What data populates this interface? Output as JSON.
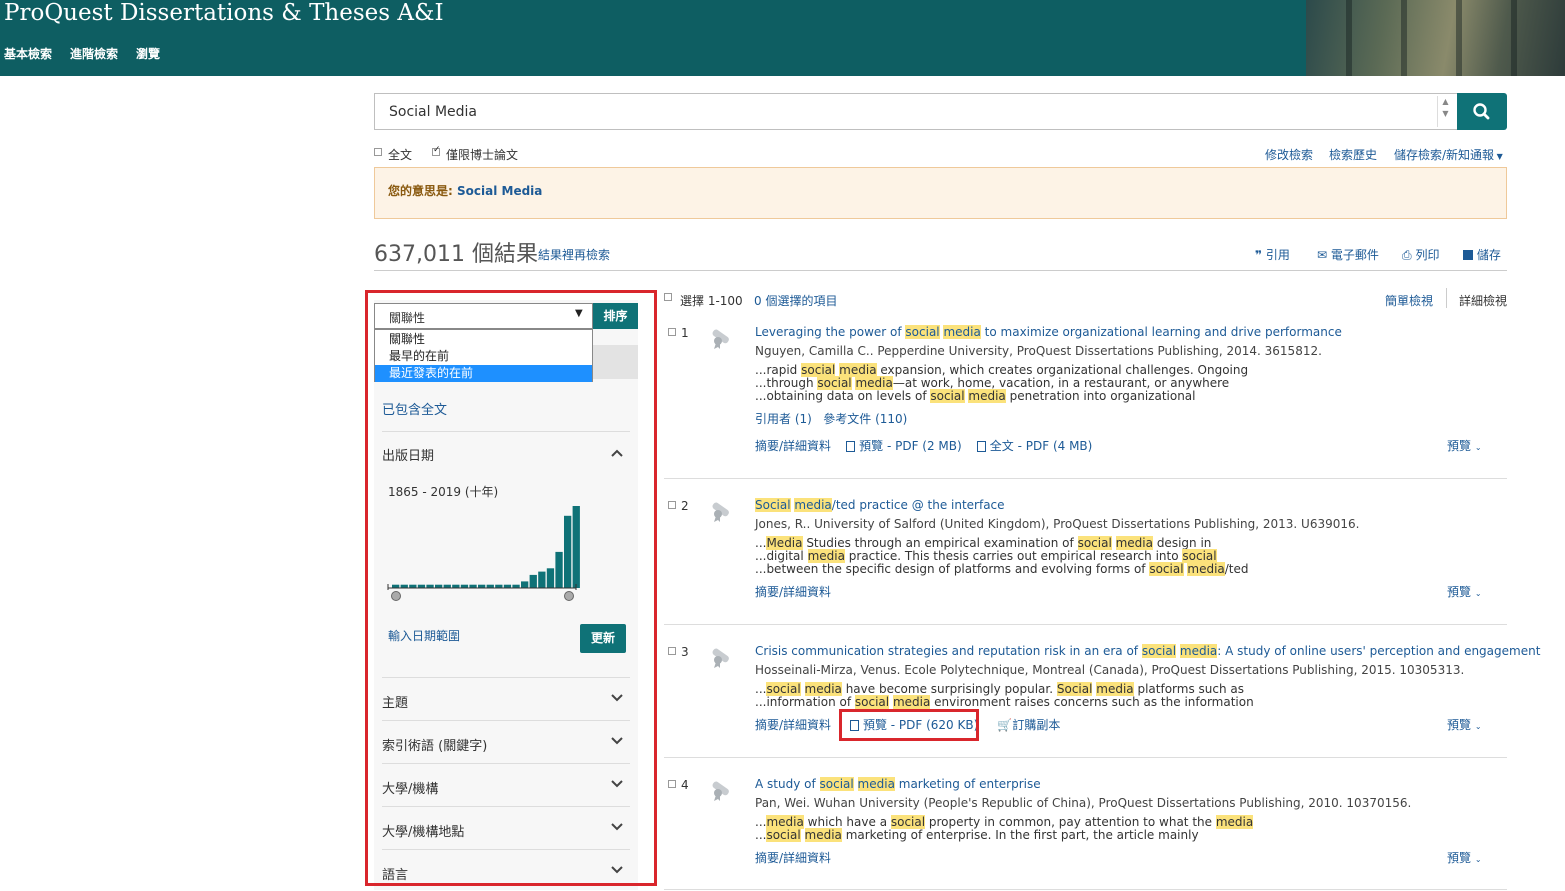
{
  "header": {
    "title": "ProQuest Dissertations & Theses A&I",
    "nav": [
      "基本檢索",
      "進階檢索",
      "瀏覽"
    ]
  },
  "search": {
    "query": "Social Media",
    "fulltext_label": "全文",
    "doctoral_only_label": "僅限博士論文",
    "doctoral_only_checked": true,
    "modify_search": "修改檢索",
    "search_history": "檢索歷史",
    "save_search": "儲存檢索/新知通報"
  },
  "didyoumean": {
    "label": "您的意思是:",
    "suggestion": "Social Media"
  },
  "results_header": {
    "count": "637,011 個結果",
    "refine": "結果裡再檢索",
    "actions": [
      "引用",
      "電子郵件",
      "列印",
      "儲存"
    ]
  },
  "sidebar": {
    "sort_selected": "關聯性",
    "sort_button": "排序",
    "sort_options": [
      "關聯性",
      "最早的在前",
      "最近發表的在前"
    ],
    "sort_highlighted_index": 2,
    "fulltext_included": "已包含全文",
    "pub_date_label": "出版日期",
    "date_range_text": "1865 - 2019 (十年)",
    "date_histogram": [
      1,
      1,
      1,
      1,
      1,
      1,
      1,
      1,
      1,
      1,
      1,
      1,
      1,
      1,
      1,
      2,
      4,
      5,
      6,
      11,
      22,
      25
    ],
    "enter_range": "輸入日期範圍",
    "update_button": "更新",
    "facets": [
      "主題",
      "索引術語 (關鍵字)",
      "大學/機構",
      "大學/機構地點",
      "語言"
    ]
  },
  "results_toolbar": {
    "select_label": "選擇 1-100",
    "selected_count": "0 個選擇的項目",
    "brief_view": "簡單檢視",
    "detailed_view": "詳細檢視"
  },
  "results": [
    {
      "num": "1",
      "title": [
        "Leveraging the power of ",
        "social",
        " ",
        "media",
        " to maximize organizational learning and drive performance"
      ],
      "meta": "Nguyen, Camilla C.. Pepperdine University, ProQuest Dissertations Publishing, 2014. 3615812.",
      "snippets": [
        [
          "...rapid ",
          "social",
          " ",
          "media",
          " expansion, which creates organizational challenges. Ongoing"
        ],
        [
          "...through ",
          "social",
          " ",
          "media",
          "—at work, home, vacation, in a restaurant, or anywhere"
        ],
        [
          "...obtaining data on levels of ",
          "social",
          " ",
          "media",
          " penetration into organizational"
        ]
      ],
      "cited_by": "引用者 (1)",
      "references": "參考文件 (110)",
      "abstract": "摘要/詳細資料",
      "preview_pdf": "預覽 - PDF (2 MB)",
      "fulltext_pdf": "全文 - PDF (4 MB)",
      "preview_toggle": "預覽"
    },
    {
      "num": "2",
      "title": [
        "",
        "Social",
        " ",
        "media",
        "/ted practice @ the interface"
      ],
      "meta": "Jones, R.. University of Salford (United Kingdom), ProQuest Dissertations Publishing, 2013. U639016.",
      "snippets": [
        [
          "...",
          "Media",
          " Studies through an empirical examination of ",
          "social",
          " ",
          "media",
          " design in"
        ],
        [
          "...digital ",
          "media",
          " practice. This thesis carries out empirical research into ",
          "social",
          ""
        ],
        [
          "...between the specific design of platforms and evolving forms of ",
          "social",
          " ",
          "media",
          "/ted"
        ]
      ],
      "abstract": "摘要/詳細資料",
      "preview_toggle": "預覽"
    },
    {
      "num": "3",
      "title": [
        "Crisis communication strategies and reputation risk in an era of ",
        "social",
        " ",
        "media",
        ": A study of online users' perception and engagement"
      ],
      "meta": "Hosseinali-Mirza, Venus. Ecole Polytechnique, Montreal (Canada), ProQuest Dissertations Publishing, 2015. 10305313.",
      "snippets": [
        [
          "...",
          "social",
          " ",
          "media",
          " have become surprisingly popular. ",
          "Social",
          " ",
          "media",
          " platforms such as"
        ],
        [
          "...information of ",
          "social",
          " ",
          "media",
          " environment raises concerns such as the information"
        ]
      ],
      "abstract": "摘要/詳細資料",
      "preview_pdf": "預覽 - PDF (620 KB)",
      "order_copy": "訂購副本",
      "preview_toggle": "預覽"
    },
    {
      "num": "4",
      "title": [
        "A study of ",
        "social",
        " ",
        "media",
        " marketing of enterprise"
      ],
      "meta": "Pan, Wei. Wuhan University (People's Republic of China), ProQuest Dissertations Publishing, 2010. 10370156.",
      "snippets": [
        [
          "...",
          "media",
          " which have a ",
          "social",
          " property in common, pay attention to what the ",
          "media",
          ""
        ],
        [
          "...",
          "social",
          " ",
          "media",
          " marketing of enterprise. In the first part, the article mainly"
        ]
      ],
      "abstract": "摘要/詳細資料",
      "preview_toggle": "預覽"
    }
  ],
  "colors": {
    "header_bg": "#0e5e62",
    "accent": "#0f7277",
    "link": "#1d5a96",
    "highlight": "#fbe27b",
    "annotation_red": "#d9262c"
  }
}
